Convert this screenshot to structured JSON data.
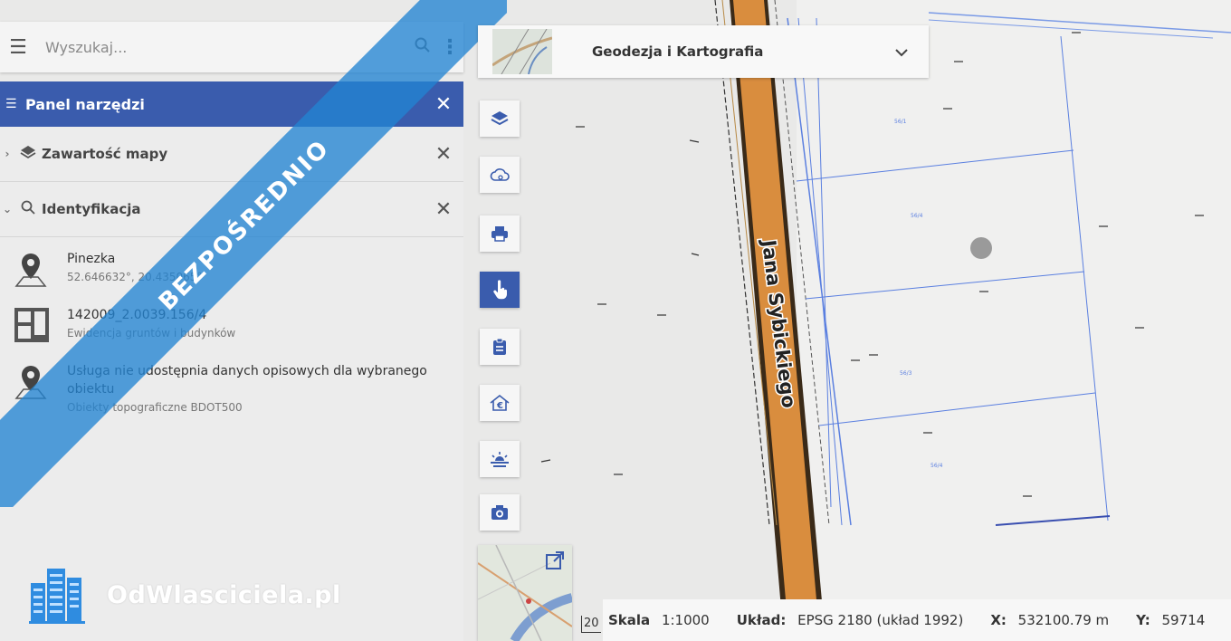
{
  "search": {
    "placeholder": "Wyszukaj..."
  },
  "panel": {
    "title": "Panel narzędzi",
    "sections": [
      {
        "label": "Zawartość mapy"
      },
      {
        "label": "Identyfikacja"
      }
    ],
    "results": [
      {
        "title": "Pinezka",
        "sub": "52.646632°, 20.435065°"
      },
      {
        "title": "142009_2.0039.156/4",
        "sub": "Ewidencja gruntów i budynków"
      },
      {
        "title": "Usługa nie udostępnia danych opisowych dla wybranego obiektu",
        "sub": "Obiekty topograficzne BDOT500"
      }
    ]
  },
  "watermark": {
    "ribbon": "BEZPOŚREDNIO",
    "brand": "OdWlasciciela.pl"
  },
  "layer_selector": {
    "selected": "Geodezja i Kartografia"
  },
  "toolbar": [
    {
      "name": "layers-button",
      "icon": "layers-icon"
    },
    {
      "name": "cloud-button",
      "icon": "cloud-icon"
    },
    {
      "name": "print-button",
      "icon": "printer-icon"
    },
    {
      "name": "identify-button",
      "icon": "pointer-hand-icon",
      "active": true
    },
    {
      "name": "clipboard-button",
      "icon": "clipboard-icon"
    },
    {
      "name": "price-button",
      "icon": "house-euro-icon"
    },
    {
      "name": "horizon-button",
      "icon": "sunrise-icon"
    },
    {
      "name": "camera-button",
      "icon": "camera-icon"
    }
  ],
  "map": {
    "street_name": "Jana Sybickiego",
    "parcels": [
      "56/1",
      "56/4",
      "56/3",
      "56/4"
    ]
  },
  "status": {
    "scale_tick": "20",
    "scale_label": "Skala",
    "scale_value": "1:1000",
    "crs_label": "Układ:",
    "crs_value": "EPSG 2180 (układ 1992)",
    "x_label": "X:",
    "x_value": "532100.79 m",
    "y_label": "Y:",
    "y_value": "59714"
  },
  "colors": {
    "accent": "#3a5cad",
    "ribbon": "#2384d2",
    "road": "#d98d3e",
    "parcel_line": "#5a7fe0"
  }
}
